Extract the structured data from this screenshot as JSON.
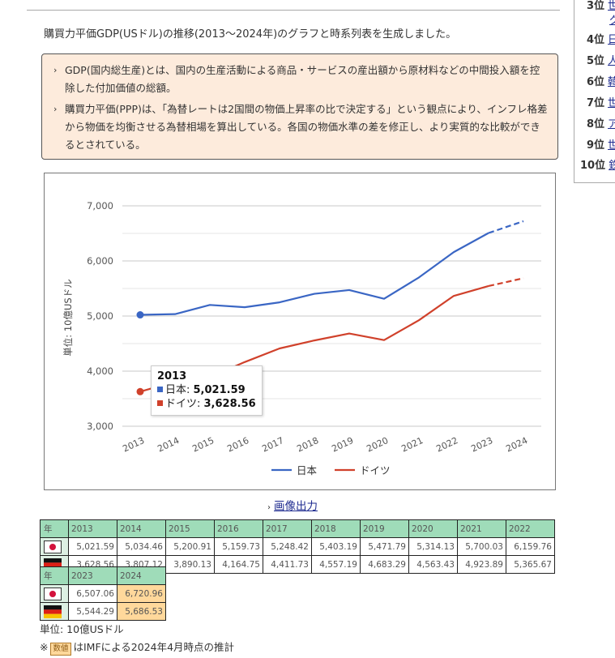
{
  "intro_text": "購買力平価GDP(USドル)の推移(2013〜2024年)のグラフと時系列表を生成しました。",
  "info": {
    "items": [
      "GDP(国内総生産)とは、国内の生産活動による商品・サービスの産出額から原材料などの中間投入額を控除した付加価値の総額。",
      "購買力平価(PPP)は、「為替レートは2国間の物価上昇率の比で決定する」という観点により、インフレ格差から物価を均衡させる為替相場を算出している。各国の物価水準の差を修正し、より実質的な比較ができるとされている。"
    ]
  },
  "sidebar": {
    "ranks": [
      {
        "rank": "3位",
        "label": "世",
        "label2": "グ"
      },
      {
        "rank": "4位",
        "label": "日"
      },
      {
        "rank": "5位",
        "label": "人"
      },
      {
        "rank": "6位",
        "label": "韓"
      },
      {
        "rank": "7位",
        "label": "世"
      },
      {
        "rank": "8位",
        "label": "ア"
      },
      {
        "rank": "9位",
        "label": "世"
      },
      {
        "rank": "10位",
        "label": "鉄"
      }
    ]
  },
  "chart_data": {
    "type": "line",
    "title": "",
    "xlabel": "",
    "ylabel": "単位: 10億USドル",
    "x": [
      "2013",
      "2014",
      "2015",
      "2016",
      "2017",
      "2018",
      "2019",
      "2020",
      "2021",
      "2022",
      "2023",
      "2024"
    ],
    "ylim": [
      3000,
      7000
    ],
    "yticks": [
      "3,000",
      "4,000",
      "5,000",
      "6,000",
      "7,000"
    ],
    "grid": true,
    "legend": "bottom",
    "estimate_from_index": 10,
    "series": [
      {
        "name": "日本",
        "color": "#3a66c4",
        "values": [
          5021.59,
          5034.46,
          5200.91,
          5159.73,
          5248.42,
          5403.19,
          5471.79,
          5314.13,
          5700.03,
          6159.76,
          6507.06,
          6720.96
        ]
      },
      {
        "name": "ドイツ",
        "color": "#d0412b",
        "values": [
          3628.56,
          3807.12,
          3890.13,
          4164.75,
          4411.73,
          4557.19,
          4683.29,
          4563.43,
          4923.89,
          5365.67,
          5544.29,
          5686.53
        ]
      }
    ],
    "tooltip": {
      "title": "2013",
      "rows": [
        {
          "label": "日本: ",
          "value": "5,021.59",
          "color": "#3a66c4"
        },
        {
          "label": "ドイツ: ",
          "value": "3,628.56",
          "color": "#d0412b"
        }
      ]
    }
  },
  "image_output_link": "画像出力",
  "table": {
    "header_label": "年",
    "rows1_years": [
      "2013",
      "2014",
      "2015",
      "2016",
      "2017",
      "2018",
      "2019",
      "2020",
      "2021",
      "2022"
    ],
    "rows2_years": [
      "2023",
      "2024"
    ],
    "japan1": [
      "5,021.59",
      "5,034.46",
      "5,200.91",
      "5,159.73",
      "5,248.42",
      "5,403.19",
      "5,471.79",
      "5,314.13",
      "5,700.03",
      "6,159.76"
    ],
    "germany1": [
      "3,628.56",
      "3,807.12",
      "3,890.13",
      "4,164.75",
      "4,411.73",
      "4,557.19",
      "4,683.29",
      "4,563.43",
      "4,923.89",
      "5,365.67"
    ],
    "japan2": [
      "6,507.06",
      "6,720.96"
    ],
    "germany2": [
      "5,544.29",
      "5,686.53"
    ],
    "estimate_years": [
      "2024"
    ]
  },
  "unit_note": "単位: 10億USドル",
  "estimate_note": {
    "prefix": "※",
    "swatch_label": "数値",
    "text": "はIMFによる2024年4月時点の推計"
  }
}
